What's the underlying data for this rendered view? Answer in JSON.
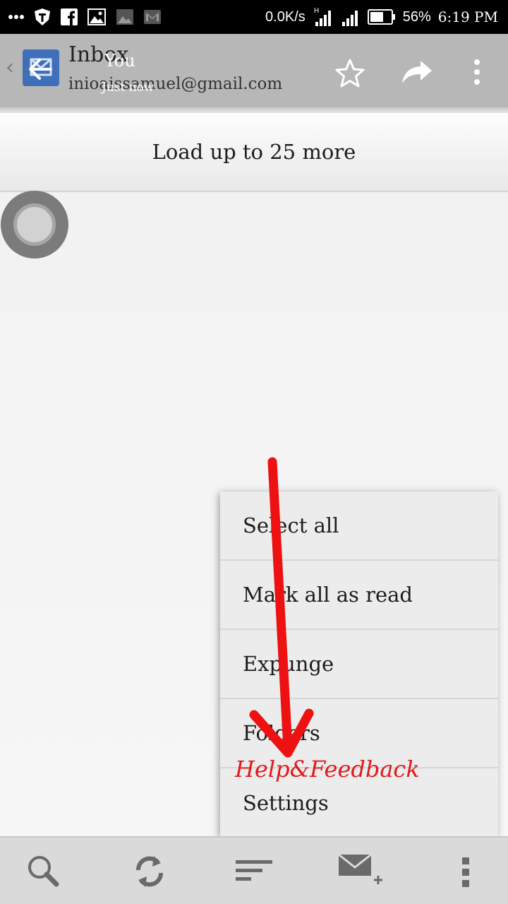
{
  "status_bar": {
    "left_icons": [
      "more-dots-icon",
      "shield-t-icon",
      "facebook-icon",
      "image-icon",
      "image-dim-icon",
      "gmail-icon"
    ],
    "network_speed": "0.0K/s",
    "network_type": "H",
    "battery": "56%",
    "time": "6:19 PM"
  },
  "action_bar": {
    "title": "Inbox",
    "account": "inioaissamuel@gmail.com",
    "overlay_sender": "You",
    "overlay_time": "Just now",
    "icons": [
      "back-arrow-icon",
      "star-icon",
      "forward-icon",
      "overflow-menu-icon"
    ]
  },
  "load_more": {
    "label": "Load up to 25 more"
  },
  "menu": {
    "items": [
      {
        "label": "Select all"
      },
      {
        "label": "Mark all as read"
      },
      {
        "label": "Expunge"
      },
      {
        "label": "Folders"
      },
      {
        "label": "Settings"
      }
    ]
  },
  "annotation": {
    "text": "Help&Feedback",
    "color": "#e01a1a"
  },
  "bottom_bar": {
    "icons": [
      "search-icon",
      "refresh-icon",
      "sort-icon",
      "compose-icon",
      "overflow-icon"
    ]
  },
  "colors": {
    "action_bar": "#b7b7b7",
    "app_icon": "#3e6fb8",
    "annotation": "#e01a1a"
  }
}
